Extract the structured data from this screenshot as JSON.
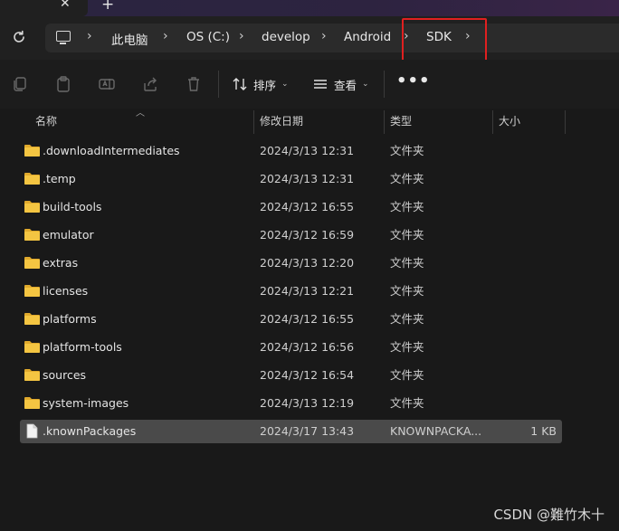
{
  "window": {
    "tab_close_glyph": "✕",
    "new_tab_glyph": "+"
  },
  "address_bar": {
    "crumbs": [
      "此电脑",
      "OS (C:)",
      "develop",
      "Android",
      "SDK"
    ],
    "separator": "›"
  },
  "toolbar": {
    "sort_label": "排序",
    "view_label": "查看",
    "more_label": "•••"
  },
  "columns": {
    "name": "名称",
    "date": "修改日期",
    "type": "类型",
    "size": "大小"
  },
  "files": [
    {
      "name": ".downloadIntermediates",
      "date": "2024/3/13 12:31",
      "type": "文件夹",
      "size": "",
      "kind": "folder"
    },
    {
      "name": ".temp",
      "date": "2024/3/13 12:31",
      "type": "文件夹",
      "size": "",
      "kind": "folder"
    },
    {
      "name": "build-tools",
      "date": "2024/3/12 16:55",
      "type": "文件夹",
      "size": "",
      "kind": "folder"
    },
    {
      "name": "emulator",
      "date": "2024/3/12 16:59",
      "type": "文件夹",
      "size": "",
      "kind": "folder"
    },
    {
      "name": "extras",
      "date": "2024/3/13 12:20",
      "type": "文件夹",
      "size": "",
      "kind": "folder"
    },
    {
      "name": "licenses",
      "date": "2024/3/13 12:21",
      "type": "文件夹",
      "size": "",
      "kind": "folder"
    },
    {
      "name": "platforms",
      "date": "2024/3/12 16:55",
      "type": "文件夹",
      "size": "",
      "kind": "folder"
    },
    {
      "name": "platform-tools",
      "date": "2024/3/12 16:56",
      "type": "文件夹",
      "size": "",
      "kind": "folder"
    },
    {
      "name": "sources",
      "date": "2024/3/12 16:54",
      "type": "文件夹",
      "size": "",
      "kind": "folder"
    },
    {
      "name": "system-images",
      "date": "2024/3/13 12:19",
      "type": "文件夹",
      "size": "",
      "kind": "folder"
    },
    {
      "name": ".knownPackages",
      "date": "2024/3/17 13:43",
      "type": "KNOWNPACKA...",
      "size": "1 KB",
      "kind": "file"
    }
  ],
  "watermark": "CSDN @難竹木十",
  "colors": {
    "folder": "#f4c542",
    "folder_tab": "#e0a92c",
    "highlight": "#e02020",
    "selected_row": "#4a4a4a"
  }
}
